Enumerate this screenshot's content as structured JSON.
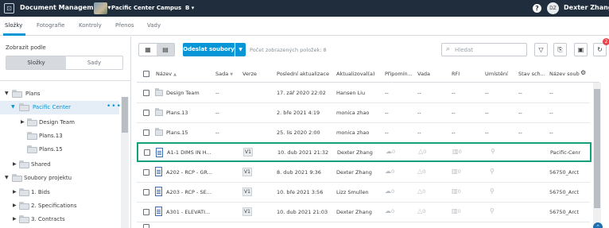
{
  "header": {
    "module": "Document Management",
    "project": "Pacific Center Campus",
    "project_suffix": "B",
    "user_initials": "DZ",
    "user_name": "Dexter Zhang"
  },
  "tabs": [
    {
      "label": "Složky",
      "active": true
    },
    {
      "label": "Fotografie"
    },
    {
      "label": "Kontroly"
    },
    {
      "label": "Přenos"
    },
    {
      "label": "Vady"
    }
  ],
  "left_panel": {
    "view_label": "Zobrazit podle",
    "segments": [
      "Složky",
      "Sady"
    ],
    "tree": [
      {
        "label": "Plans",
        "level": 0,
        "expanded": true
      },
      {
        "label": "Pacific Center",
        "level": 1,
        "expanded": true,
        "selected": true
      },
      {
        "label": "Design Team",
        "level": 2,
        "expanded": false
      },
      {
        "label": "Plans.13",
        "level": 2
      },
      {
        "label": "Plans.15",
        "level": 2
      },
      {
        "label": "Shared",
        "level": 1,
        "expanded": false
      },
      {
        "label": "Soubory projektu",
        "level": 0,
        "expanded": true
      },
      {
        "label": "1. Bids",
        "level": 1,
        "expanded": false
      },
      {
        "label": "2. Specifications",
        "level": 1,
        "expanded": false
      },
      {
        "label": "3. Contracts",
        "level": 1,
        "expanded": false
      }
    ]
  },
  "toolbar": {
    "upload_label": "Odeslat soubory",
    "count_label": "Počet zobrazených položek: 8",
    "search_placeholder": "Hledat",
    "notification_count": "2"
  },
  "table": {
    "columns": [
      "Název",
      "Sada",
      "Verze",
      "Poslední aktualizace",
      "Aktualizoval(a)",
      "Připomín...",
      "Vada",
      "RFI",
      "Umístění",
      "Stav sch...",
      "Název soub"
    ],
    "rows": [
      {
        "type": "folder",
        "name": "Design Team",
        "set": "--",
        "version": "",
        "updated": "17. zář 2020 22:02",
        "by": "Hansen Liu",
        "comments": "--",
        "issues": "--",
        "rfi": "--",
        "location": "--",
        "status": "--",
        "filename": "--"
      },
      {
        "type": "folder",
        "name": "Plans.13",
        "set": "--",
        "version": "",
        "updated": "2. bře 2021 4:19",
        "by": "monica zhao",
        "comments": "--",
        "issues": "--",
        "rfi": "--",
        "location": "--",
        "status": "--",
        "filename": "--"
      },
      {
        "type": "folder",
        "name": "Plans.15",
        "set": "--",
        "version": "",
        "updated": "25. lis 2020 2:00",
        "by": "monica zhao",
        "comments": "--",
        "issues": "--",
        "rfi": "--",
        "location": "--",
        "status": "--",
        "filename": "--"
      },
      {
        "type": "doc",
        "name": "A1-1 DIMS IN H...",
        "set": "",
        "version": "V1",
        "updated": "10. dub 2021 21:32",
        "by": "Dexter Zhang",
        "comments": "0",
        "issues": "0",
        "rfi": "0",
        "location": "",
        "status": "",
        "filename": "Pacific-Cenr",
        "highlight": true
      },
      {
        "type": "doc",
        "name": "A202 - RCP - GR...",
        "set": "",
        "version": "V1",
        "updated": "8. dub 2021 9:36",
        "by": "Dexter Zhang",
        "comments": "0",
        "issues": "0",
        "rfi": "0",
        "location": "",
        "status": "",
        "filename": "56750_Arct"
      },
      {
        "type": "doc",
        "name": "A203 - RCP - SE...",
        "set": "",
        "version": "V1",
        "updated": "10. bře 2021 3:56",
        "by": "Lizz Smullen",
        "comments": "0",
        "issues": "0",
        "rfi": "0",
        "location": "",
        "status": "",
        "filename": "56750_Arct"
      },
      {
        "type": "doc",
        "name": "A301 - ELEVATI...",
        "set": "",
        "version": "V1",
        "updated": "10. dub 2021 21:03",
        "by": "Dexter Zhang",
        "comments": "0",
        "issues": "0",
        "rfi": "0",
        "location": "",
        "status": "",
        "filename": "56750_Arct"
      }
    ]
  }
}
